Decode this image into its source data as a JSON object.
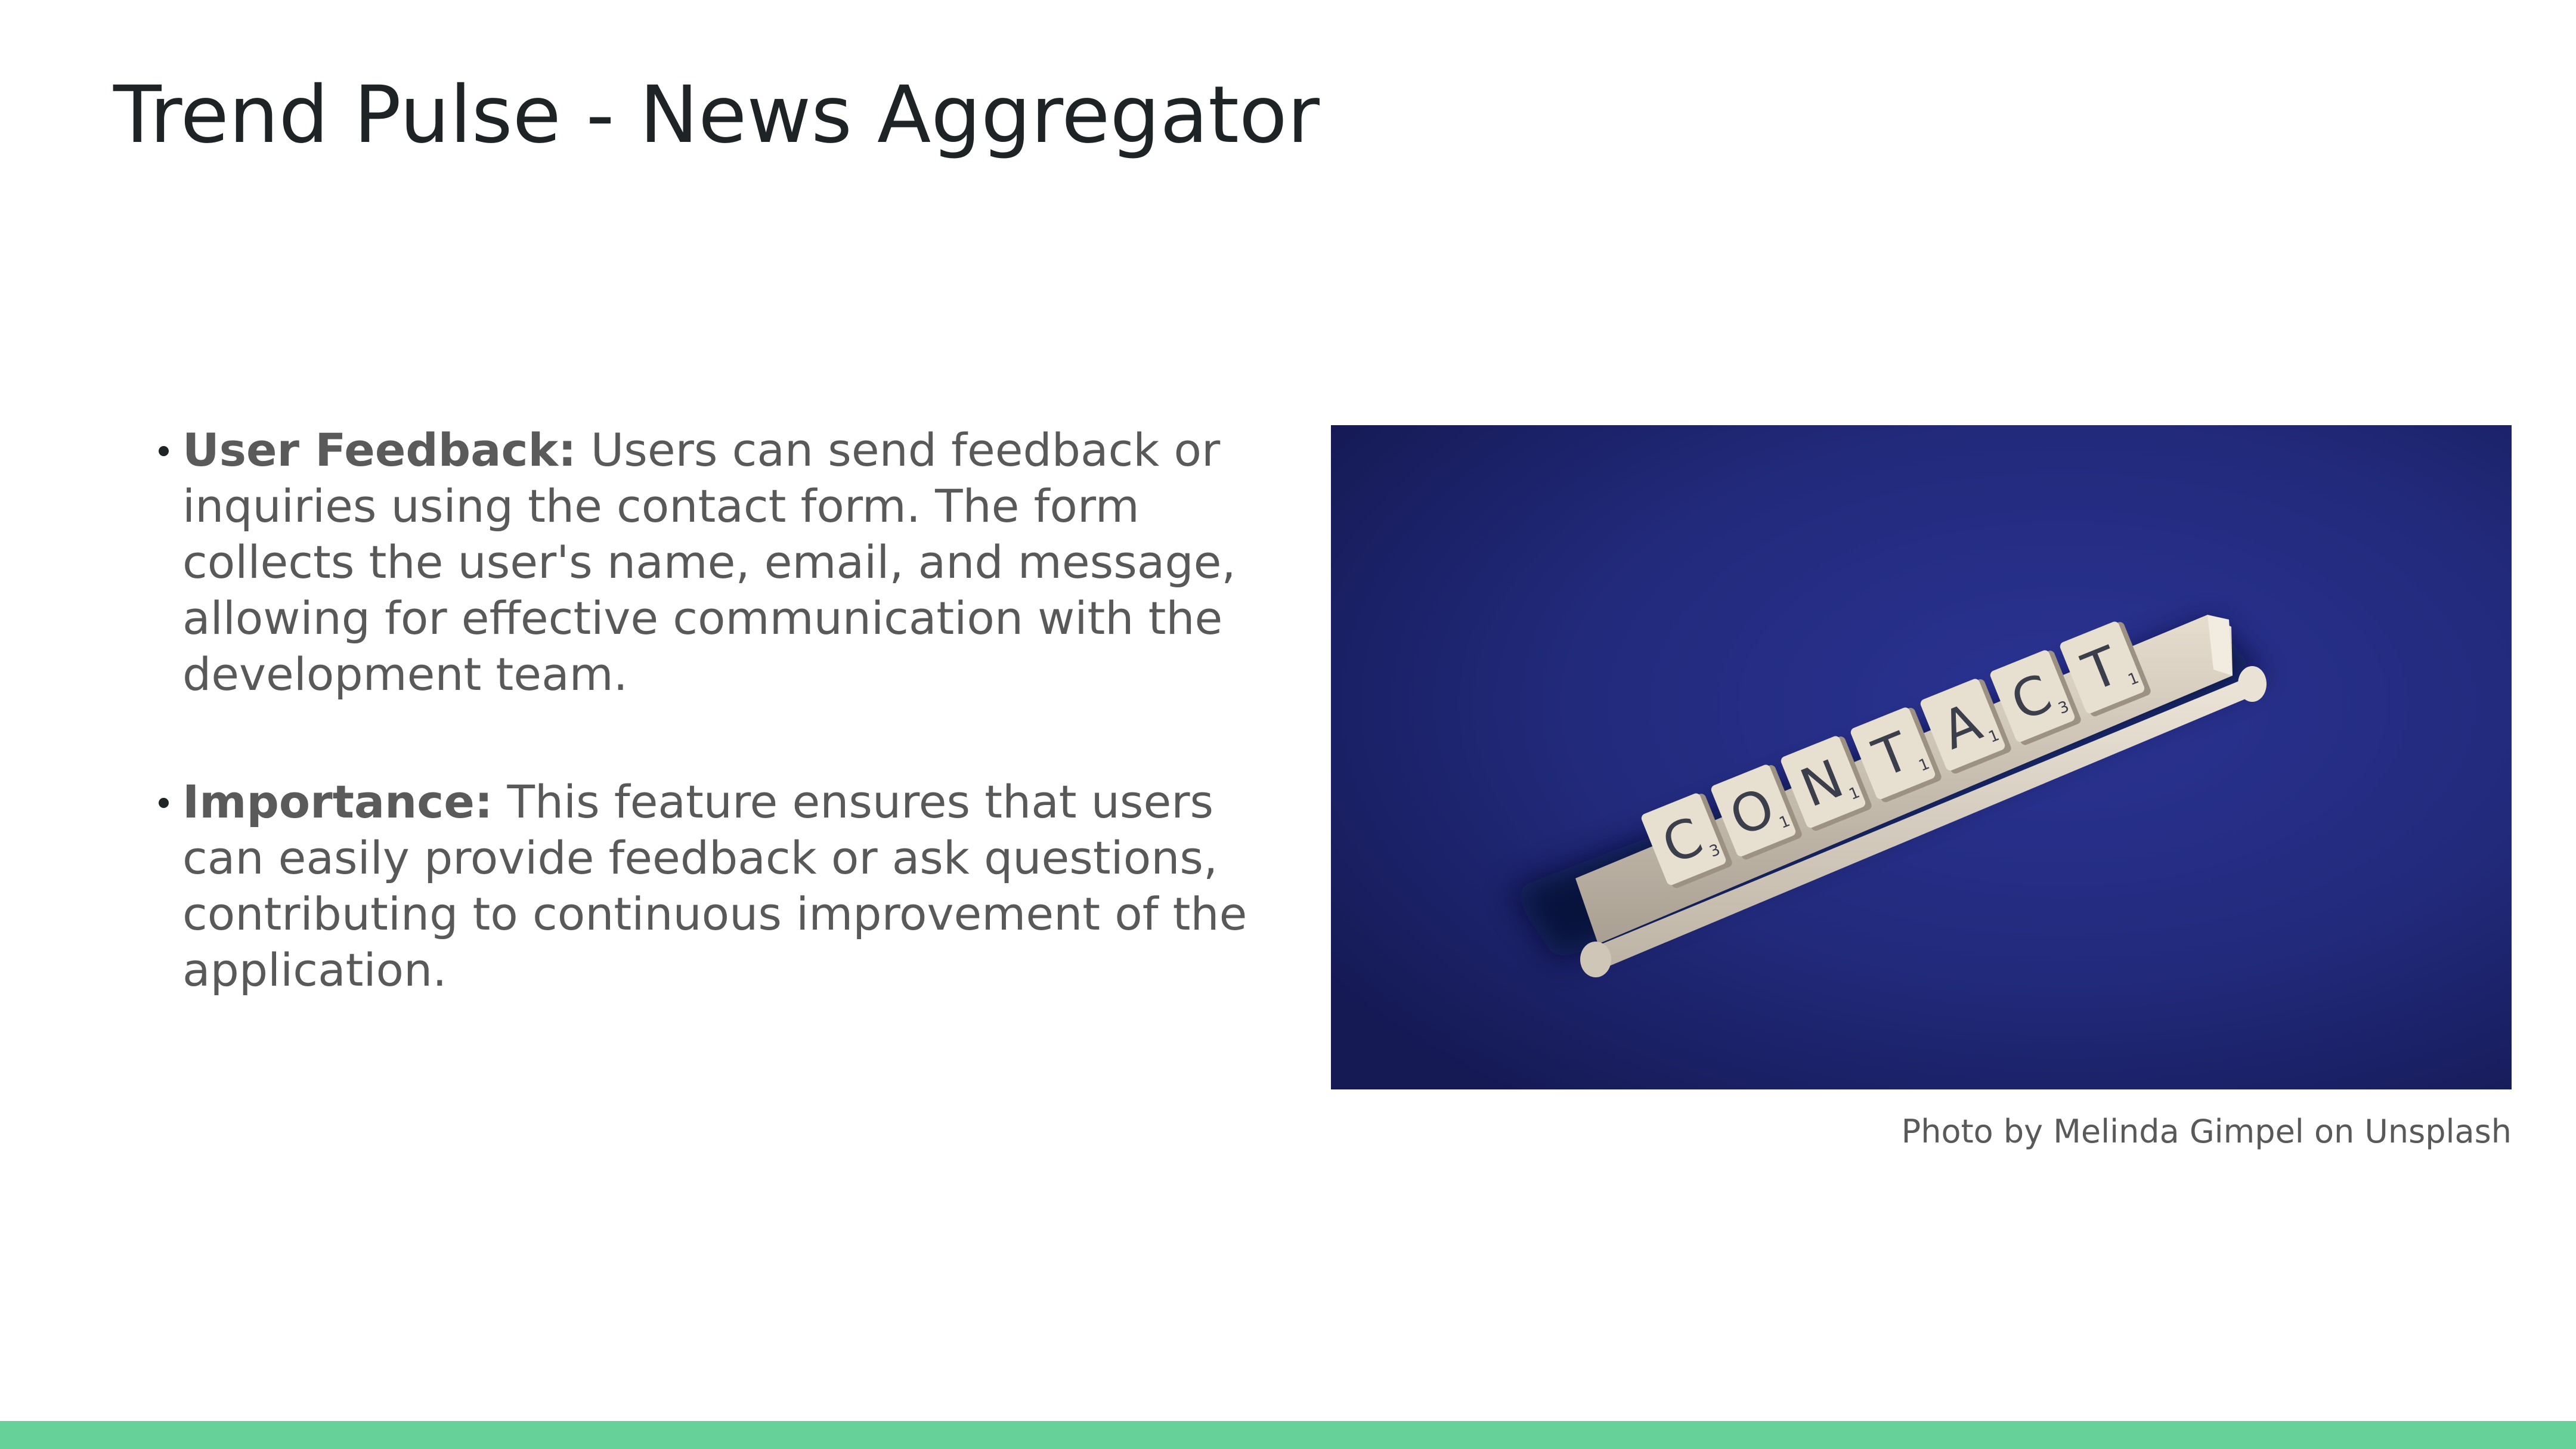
{
  "slide": {
    "title": "Trend Pulse - News Aggregator",
    "bullets": [
      {
        "heading": "User Feedback:",
        "text": " Users can send feedback or inquiries using the contact form. The form collects the user's name, email, and message, allowing for effective communication with the development team."
      },
      {
        "heading": "Importance:",
        "text": " This feature ensures that users can easily provide feedback or ask questions, contributing to continuous improvement of the application."
      }
    ],
    "photo": {
      "tiles": [
        {
          "letter": "C",
          "score": "3"
        },
        {
          "letter": "O",
          "score": "1"
        },
        {
          "letter": "N",
          "score": "1"
        },
        {
          "letter": "T",
          "score": "1"
        },
        {
          "letter": "A",
          "score": "1"
        },
        {
          "letter": "C",
          "score": "3"
        },
        {
          "letter": "T",
          "score": "1"
        }
      ]
    },
    "caption": "Photo by Melinda Gimpel on Unsplash"
  },
  "colors": {
    "title": "#1e2326",
    "body_text": "#595959",
    "photo_background": "#1c2268",
    "footer_bar": "#66d198"
  }
}
